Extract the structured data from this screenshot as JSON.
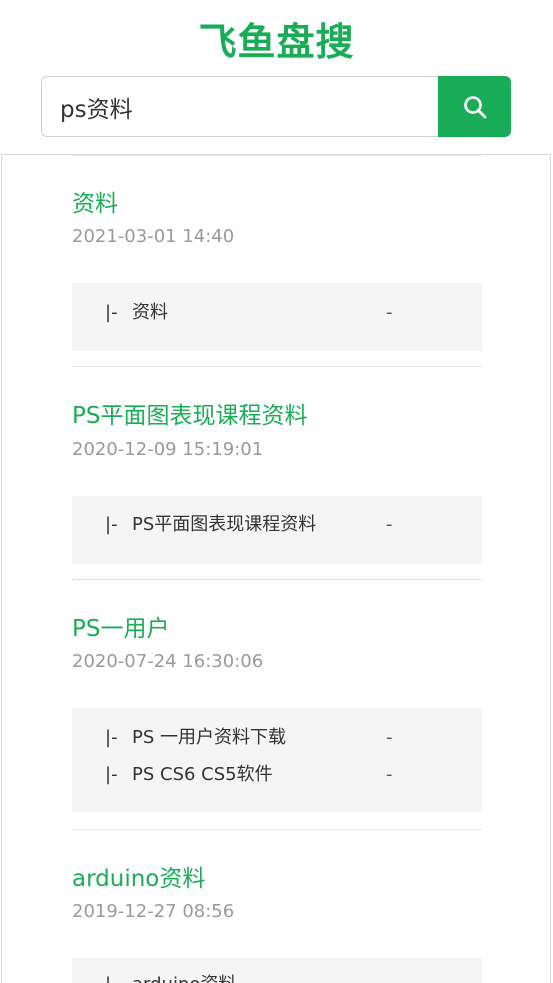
{
  "header": {
    "brand": "飞鱼盘搜"
  },
  "search": {
    "query": "ps资料",
    "button_icon": "search-icon"
  },
  "colors": {
    "accent": "#1aad57",
    "date": "#9a9a9a",
    "file_box_bg": "#f5f5f5"
  },
  "results": [
    {
      "title": "资料",
      "date": "2021-03-01 14:40",
      "files": [
        {
          "prefix": "|-",
          "name": "资料",
          "size": "-"
        }
      ]
    },
    {
      "title": "PS平面图表现课程资料",
      "date": "2020-12-09 15:19:01",
      "files": [
        {
          "prefix": "|-",
          "name": "PS平面图表现课程资料",
          "size": "-"
        }
      ]
    },
    {
      "title": "PS一用户",
      "date": "2020-07-24 16:30:06",
      "files": [
        {
          "prefix": "|-",
          "name": "PS 一用户资料下载",
          "size": "-"
        },
        {
          "prefix": "|-",
          "name": "PS CS6 CS5软件",
          "size": "-"
        }
      ]
    },
    {
      "title": "arduino资料",
      "date": "2019-12-27 08:56",
      "files": [
        {
          "prefix": "|-",
          "name": "arduino资料",
          "size": "-"
        }
      ]
    }
  ]
}
